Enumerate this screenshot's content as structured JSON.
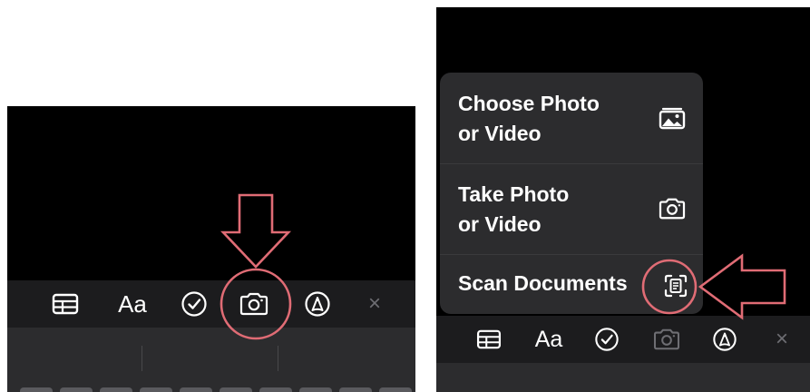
{
  "left_panel": {
    "toolbar": {
      "format_label": "Aa",
      "close_glyph": "×",
      "icons": [
        "table-icon",
        "text-format-icon",
        "checklist-icon",
        "camera-icon",
        "markup-pen-icon",
        "close-icon"
      ]
    }
  },
  "right_panel": {
    "menu": {
      "items": [
        {
          "label": "Choose Photo\nor Video",
          "icon": "photo-library-icon"
        },
        {
          "label": "Take Photo\nor Video",
          "icon": "camera-icon"
        },
        {
          "label": "Scan Documents",
          "icon": "document-scan-icon"
        }
      ]
    },
    "toolbar": {
      "format_label": "Aa",
      "close_glyph": "×",
      "icons": [
        "table-icon",
        "text-format-icon",
        "checklist-icon",
        "camera-icon",
        "markup-pen-icon",
        "close-icon"
      ]
    }
  },
  "colors": {
    "background": "#000000",
    "toolbar": "#1c1c1e",
    "menu": "#2c2c2e",
    "annotation": "#e06c75",
    "muted": "#6e6e73"
  }
}
